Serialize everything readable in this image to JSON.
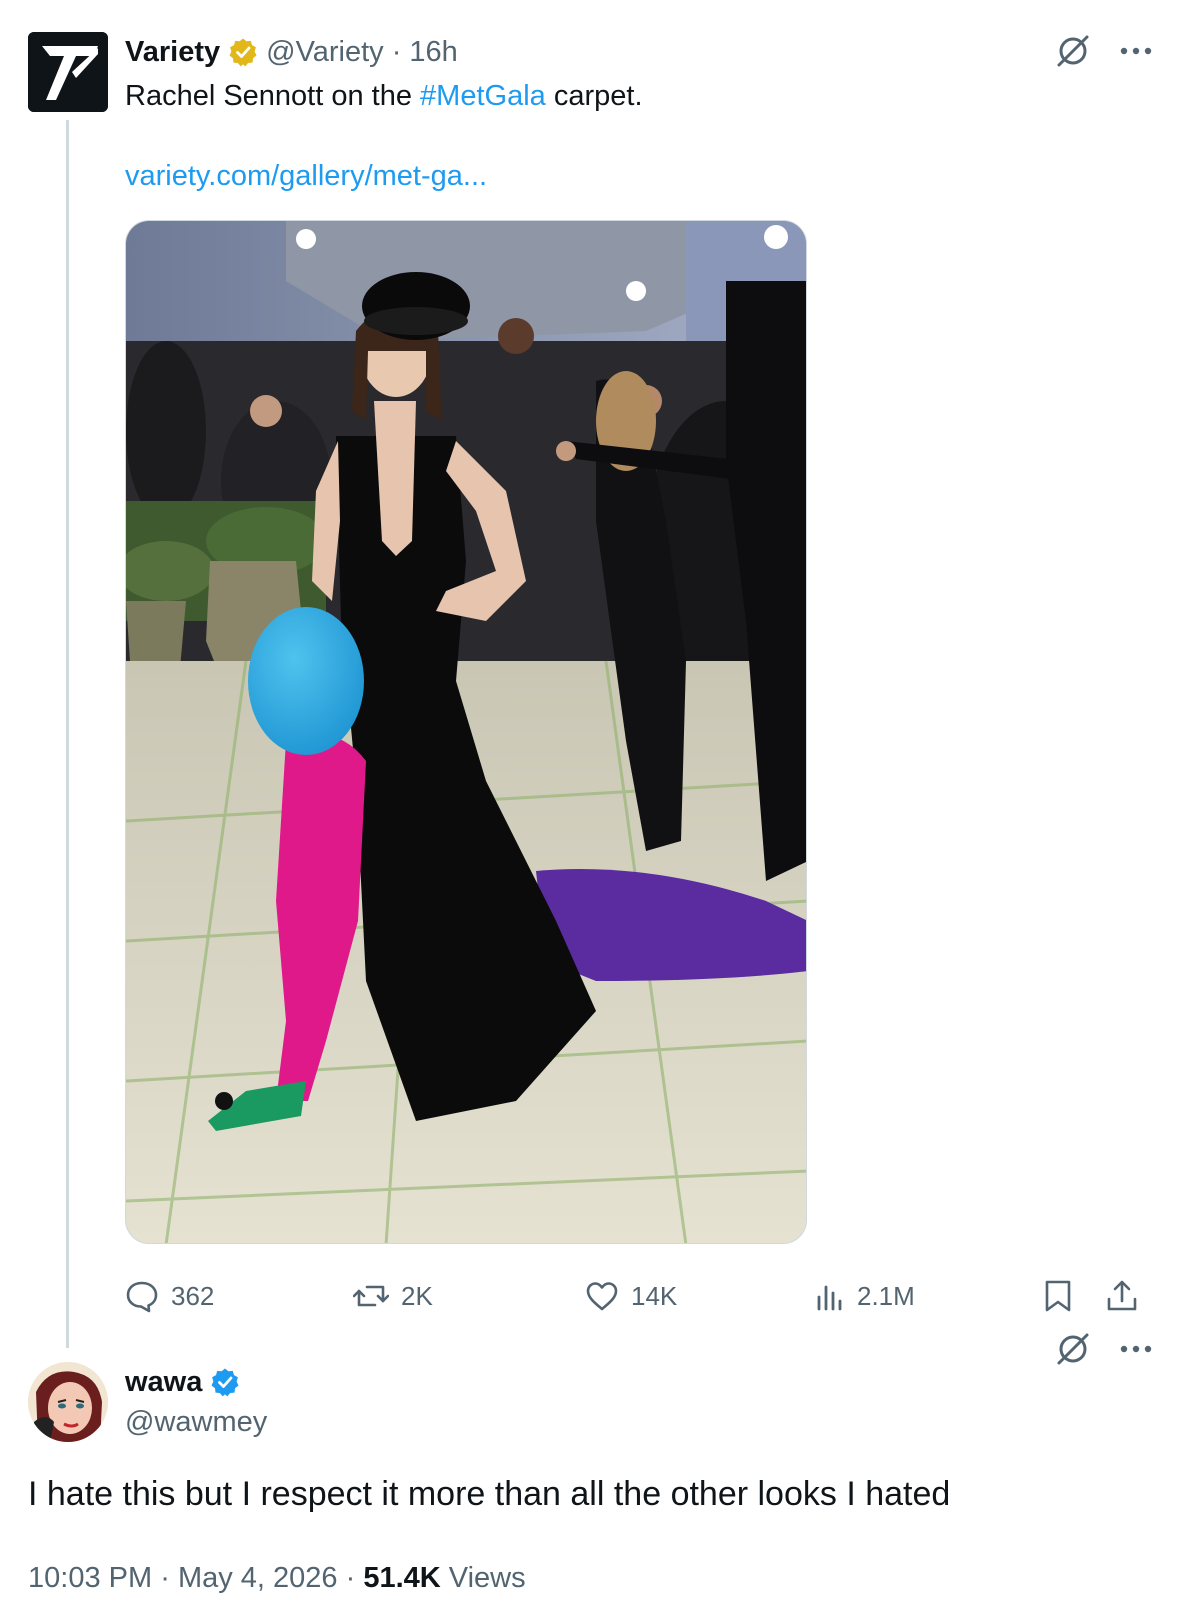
{
  "tweet1": {
    "display_name": "Variety",
    "handle": "@Variety",
    "separator": "·",
    "time": "16h",
    "text_before": "Rachel Sennott on the ",
    "hashtag": "#MetGala",
    "text_after": " carpet.",
    "link": "variety.com/gallery/met-ga...",
    "badge_color": "#e2b719",
    "metrics": {
      "replies": "362",
      "reposts": "2K",
      "likes": "14K",
      "views": "2.1M"
    }
  },
  "tweet2": {
    "display_name": "wawa",
    "handle": "@wawmey",
    "badge_color": "#1d9bf0",
    "text": "I hate this but I respect it more than all the other looks I hated",
    "time": "10:03 PM",
    "date": "May 4, 2026",
    "views_count": "51.4K",
    "views_label": "Views",
    "separator": "·"
  },
  "colors": {
    "accent": "#1d9bf0",
    "muted": "#536471",
    "text": "#0f1419",
    "thread_line": "#cfd9de"
  },
  "icons": [
    "grok-icon",
    "more-icon",
    "reply-icon",
    "repost-icon",
    "like-icon",
    "views-icon",
    "bookmark-icon",
    "share-icon",
    "verified-badge-icon"
  ]
}
